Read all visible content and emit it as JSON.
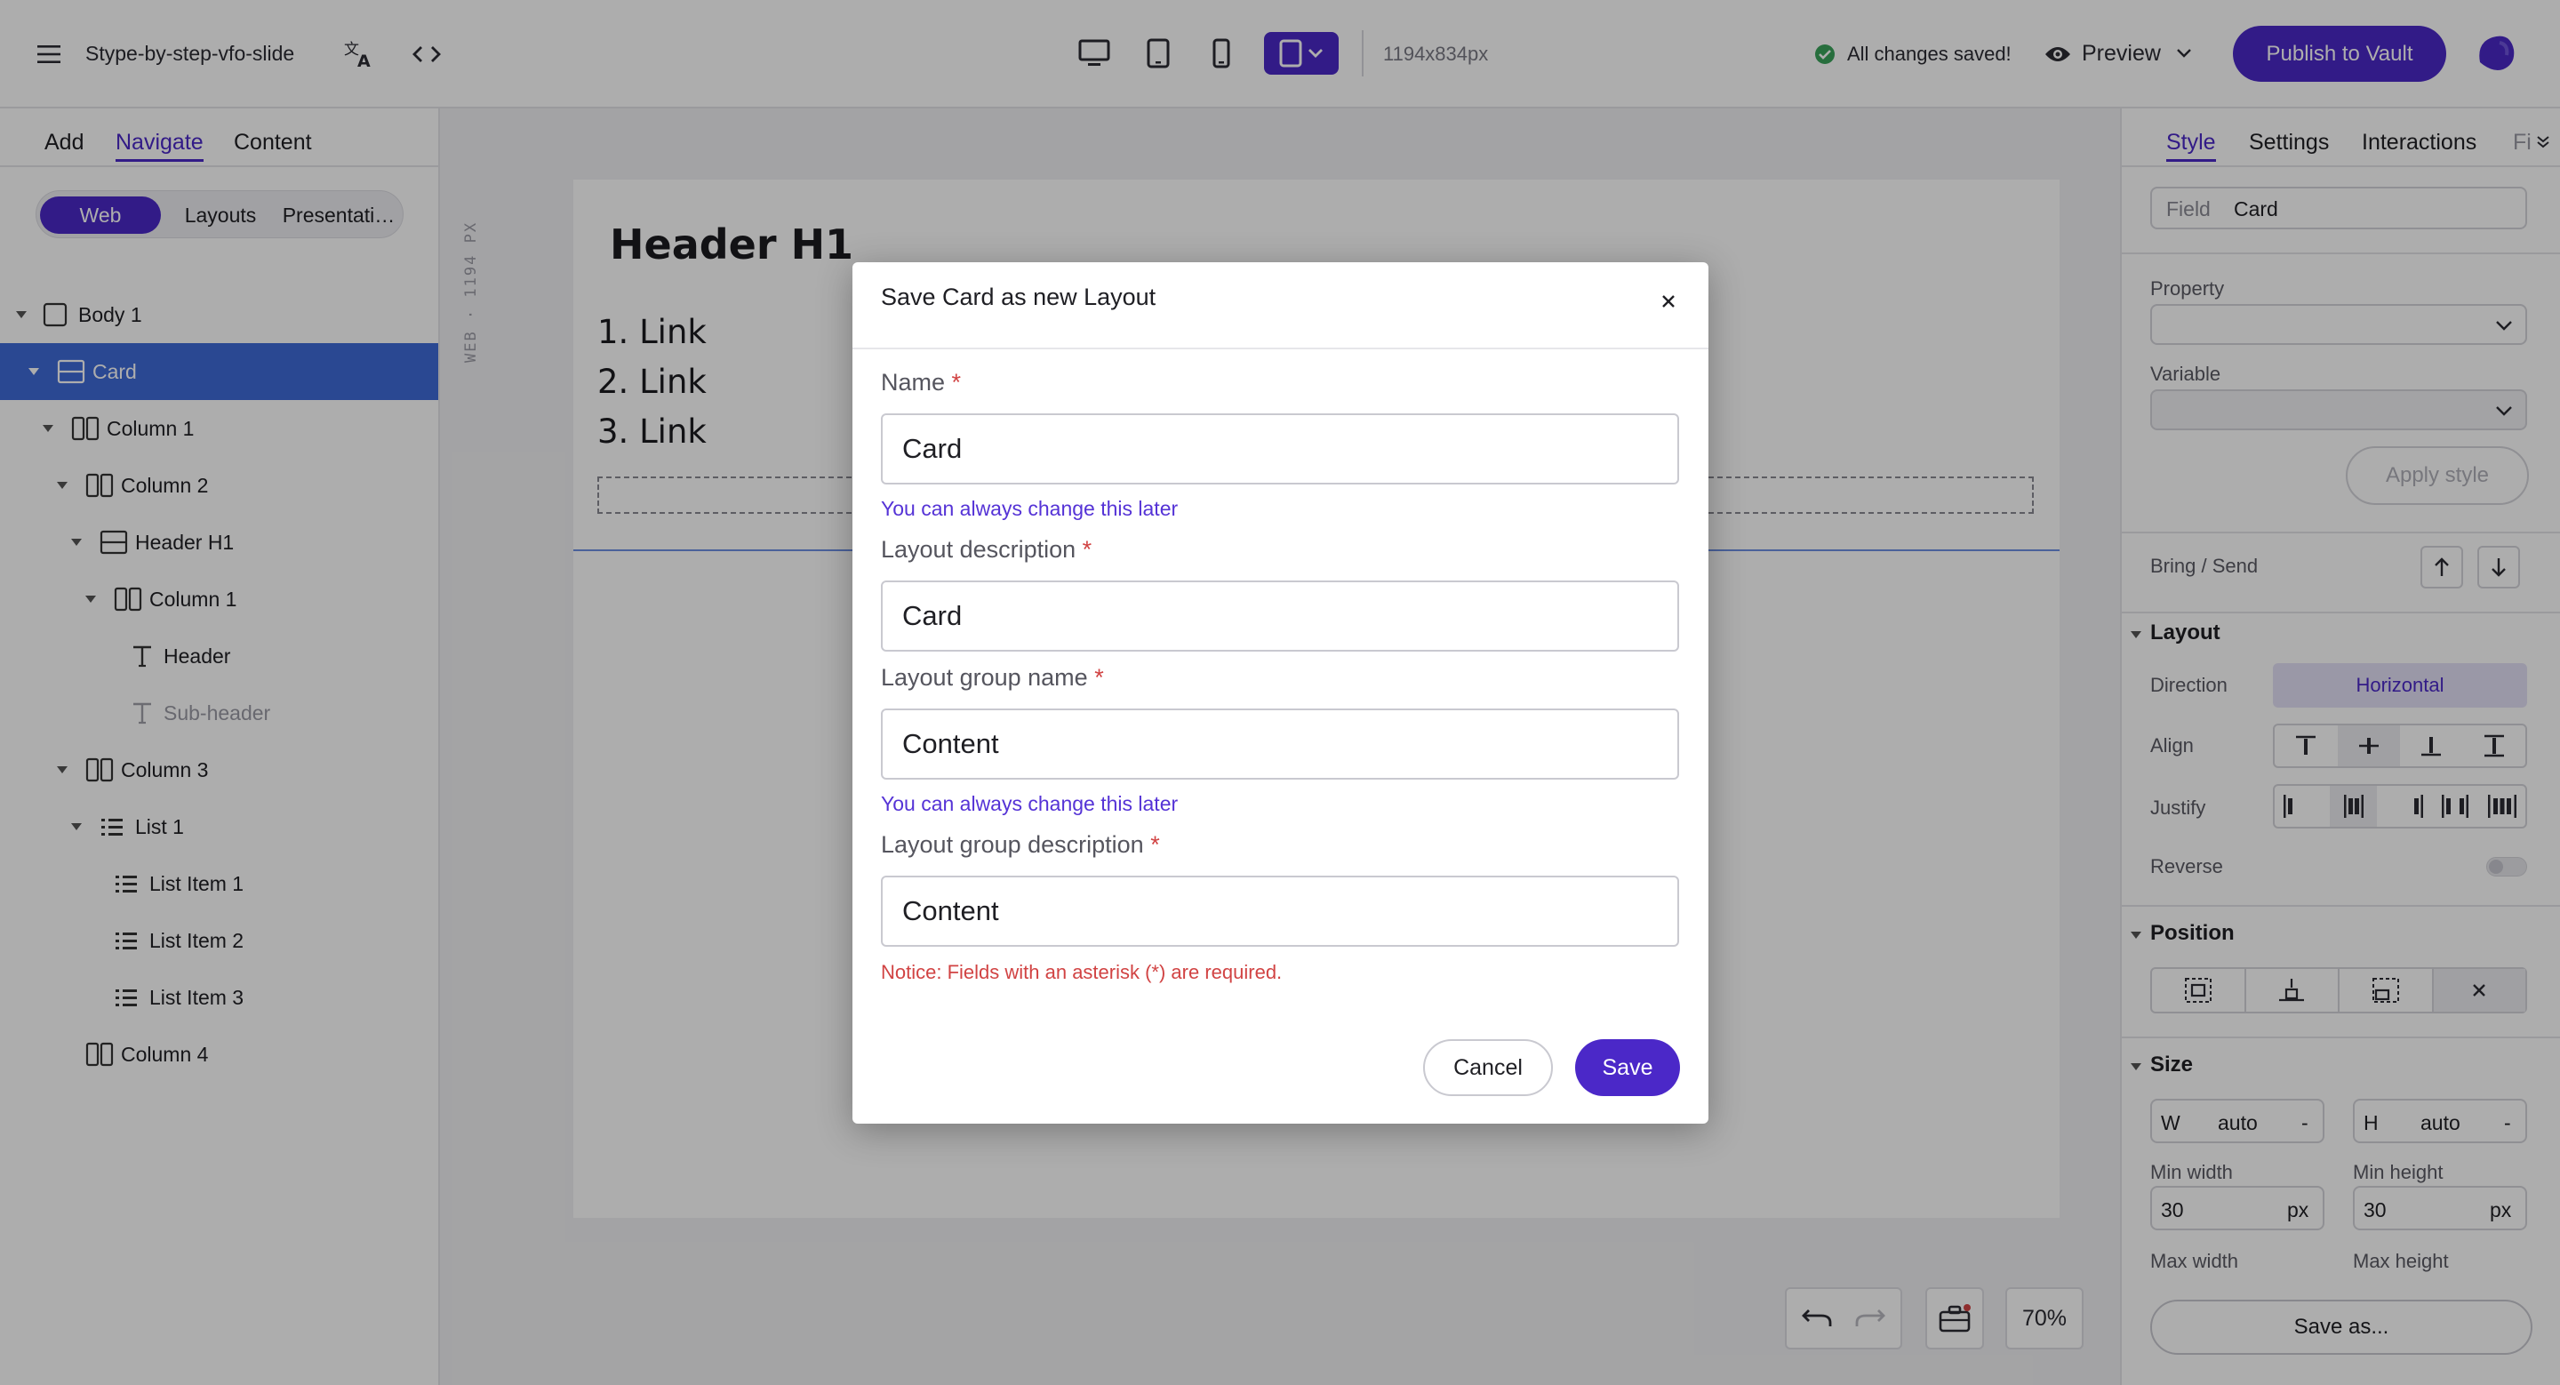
{
  "topbar": {
    "project_name": "Stype-by-step-vfo-slide",
    "dimensions": "1194x834px",
    "save_status": "All changes saved!",
    "preview_label": "Preview",
    "publish_label": "Publish to Vault"
  },
  "left_panel": {
    "tabs": [
      {
        "label": "Add"
      },
      {
        "label": "Navigate",
        "active": true
      },
      {
        "label": "Content"
      }
    ],
    "segments": [
      {
        "label": "Web",
        "active": true
      },
      {
        "label": "Layouts"
      },
      {
        "label": "Presentati…"
      }
    ],
    "tree": [
      {
        "label": "Body 1",
        "icon": "box-icon"
      },
      {
        "label": "Card",
        "icon": "card-icon",
        "selected": true
      },
      {
        "label": "Column 1",
        "icon": "columns-icon"
      },
      {
        "label": "Column 2",
        "icon": "columns-icon"
      },
      {
        "label": "Header H1",
        "icon": "card-icon"
      },
      {
        "label": "Column 1",
        "icon": "columns-icon"
      },
      {
        "label": "Header",
        "icon": "text-icon"
      },
      {
        "label": "Sub-header",
        "icon": "text-icon",
        "dim": true
      },
      {
        "label": "Column 3",
        "icon": "columns-icon"
      },
      {
        "label": "List 1",
        "icon": "list-icon"
      },
      {
        "label": "List Item 1",
        "icon": "list-icon"
      },
      {
        "label": "List Item 2",
        "icon": "list-icon"
      },
      {
        "label": "List Item 3",
        "icon": "list-icon"
      },
      {
        "label": "Column 4",
        "icon": "columns-icon"
      }
    ]
  },
  "canvas": {
    "ruler_label": "WEB · 1194 PX",
    "heading": "Header H1",
    "links": [
      "1. Link",
      "2. Link",
      "3. Link"
    ],
    "zoom": "70%"
  },
  "right_panel": {
    "tabs": [
      "Style",
      "Settings",
      "Interactions",
      "Fi"
    ],
    "field_label": "Field",
    "field_value": "Card",
    "property_label": "Property",
    "variable_label": "Variable",
    "apply_style_label": "Apply style",
    "bring_send_label": "Bring / Send",
    "layout_section": "Layout",
    "direction_label": "Direction",
    "direction_value": "Horizontal",
    "align_label": "Align",
    "justify_label": "Justify",
    "reverse_label": "Reverse",
    "position_section": "Position",
    "size_section": "Size",
    "width_prefix": "W",
    "width_value": "auto",
    "height_prefix": "H",
    "height_value": "auto",
    "dash": "-",
    "min_width_label": "Min width",
    "min_width_value": "30",
    "min_height_label": "Min height",
    "min_height_value": "30",
    "unit": "px",
    "max_width_label": "Max width",
    "max_height_label": "Max height",
    "save_as_label": "Save as..."
  },
  "modal": {
    "title": "Save Card as new Layout",
    "asterisk": "*",
    "name_label": "Name",
    "name_value": "Card",
    "name_hint": "You can always change this later",
    "layout_desc_label": "Layout description",
    "layout_desc_value": "Card",
    "group_name_label": "Layout group name",
    "group_name_value": "Content",
    "group_name_hint": "You can always change this later",
    "group_desc_label": "Layout group description",
    "group_desc_value": "Content",
    "notice": "Notice: Fields with an asterisk (*) are required.",
    "cancel_label": "Cancel",
    "save_label": "Save"
  },
  "colors": {
    "accent": "#4b28c8",
    "selection": "#3f6ad8",
    "success": "#3aa35b",
    "error": "#d14343"
  }
}
